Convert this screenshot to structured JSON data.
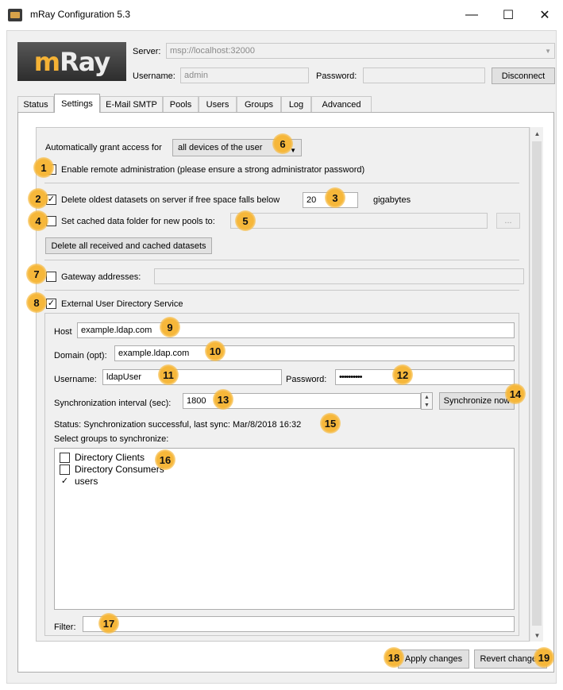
{
  "window": {
    "title": "mRay Configuration 5.3",
    "minimize": "—",
    "maximize": "☐",
    "close": "✕"
  },
  "logo": {
    "m": "m",
    "rest": "Ray"
  },
  "connection": {
    "server_label": "Server:",
    "server_value": "msp://localhost:32000",
    "username_label": "Username:",
    "username_value": "admin",
    "password_label": "Password:",
    "password_value": "",
    "disconnect": "Disconnect"
  },
  "tabs": [
    "Status",
    "Settings",
    "E-Mail SMTP",
    "Pools",
    "Users",
    "Groups",
    "Log",
    "Advanced"
  ],
  "active_tab": "Settings",
  "settings": {
    "grant_label": "Automatically grant access for",
    "grant_value": "all devices of the user",
    "remote_admin_label": "Enable remote administration (please ensure a strong administrator password)",
    "remote_admin_checked": false,
    "delete_oldest_label": "Delete oldest datasets on server if free space falls below",
    "delete_oldest_checked": true,
    "gigabytes_value": "20",
    "gigabytes_unit": "gigabytes",
    "cache_folder_label": "Set cached data folder for new pools to:",
    "cache_folder_checked": false,
    "cache_folder_value": "",
    "browse": "...",
    "delete_all": "Delete all received and cached datasets",
    "gateway_label": "Gateway addresses:",
    "gateway_checked": false,
    "gateway_value": "",
    "ldap_label": "External User Directory Service",
    "ldap_checked": true
  },
  "ldap": {
    "host_label": "Host",
    "host_value": "example.ldap.com",
    "domain_label": "Domain (opt):",
    "domain_value": "example.ldap.com",
    "username_label": "Username:",
    "username_value": "ldapUser",
    "password_label": "Password:",
    "password_value": "••••••••••",
    "interval_label": "Synchronization interval (sec):",
    "interval_value": "1800",
    "sync_now": "Synchronize now",
    "status": "Status:  Synchronization successful, last sync: Mar/8/2018 16:32",
    "groups_label": "Select groups to synchronize:",
    "groups": [
      {
        "name": "Directory Clients",
        "checked": false
      },
      {
        "name": "Directory Consumers",
        "checked": false
      },
      {
        "name": "users",
        "checked": true
      }
    ],
    "filter_label": "Filter:",
    "filter_value": ""
  },
  "actions": {
    "apply": "Apply changes",
    "revert": "Revert changes"
  },
  "callouts": [
    "1",
    "2",
    "3",
    "4",
    "5",
    "6",
    "7",
    "8",
    "9",
    "10",
    "11",
    "12",
    "13",
    "14",
    "15",
    "16",
    "17",
    "18",
    "19"
  ]
}
